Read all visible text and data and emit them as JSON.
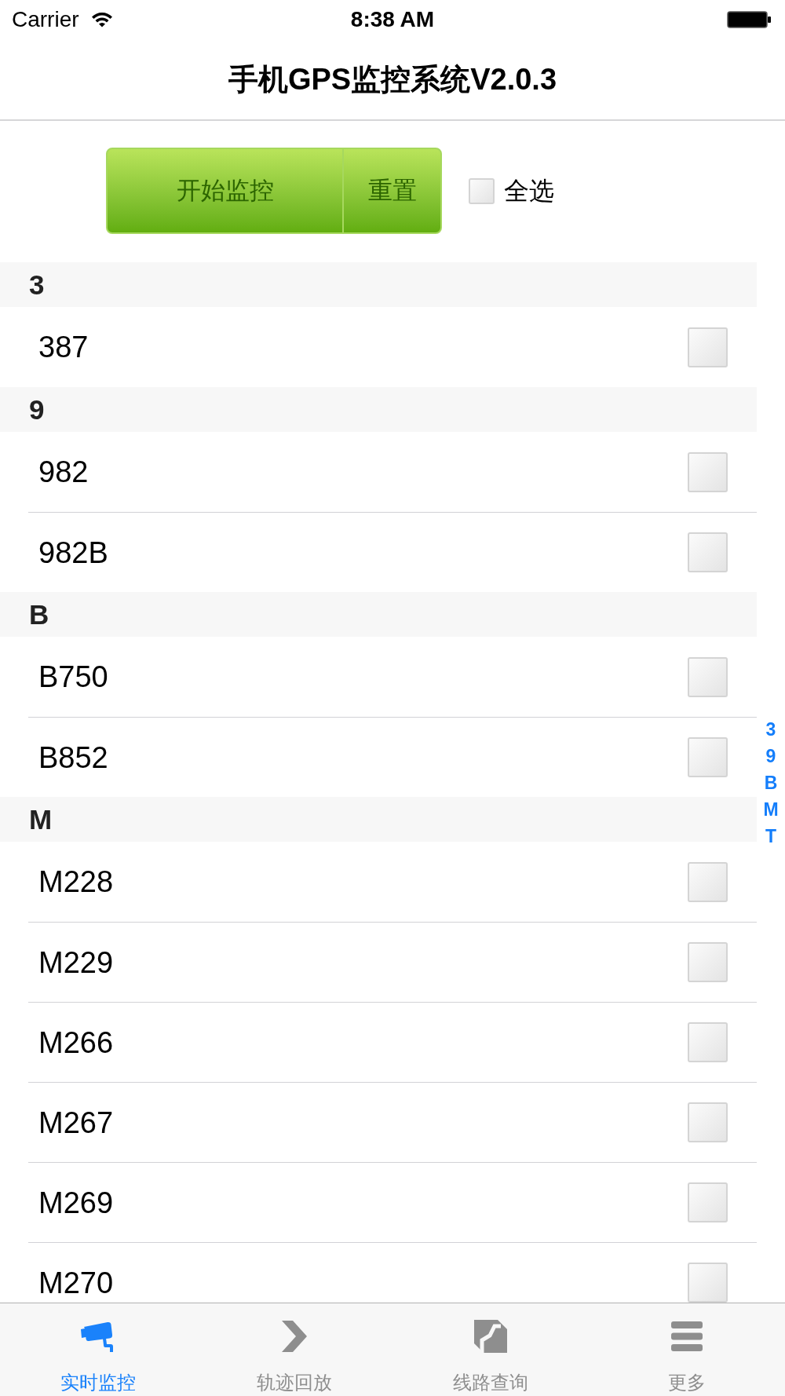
{
  "status_bar": {
    "carrier": "Carrier",
    "time": "8:38 AM"
  },
  "nav_bar": {
    "title": "手机GPS监控系统V2.0.3"
  },
  "toolbar": {
    "start_button": {
      "label": "开始监控"
    },
    "reset_button": {
      "label": "重置"
    },
    "select_all": {
      "label": "全选",
      "checked": false
    }
  },
  "sections": [
    {
      "header": "3",
      "rows": [
        {
          "label": "387",
          "checked": false
        }
      ]
    },
    {
      "header": "9",
      "rows": [
        {
          "label": "982",
          "checked": false
        },
        {
          "label": "982B",
          "checked": false
        }
      ]
    },
    {
      "header": "B",
      "rows": [
        {
          "label": "B750",
          "checked": false
        },
        {
          "label": "B852",
          "checked": false
        }
      ]
    },
    {
      "header": "M",
      "rows": [
        {
          "label": "M228",
          "checked": false
        },
        {
          "label": "M229",
          "checked": false
        },
        {
          "label": "M266",
          "checked": false
        },
        {
          "label": "M267",
          "checked": false
        },
        {
          "label": "M269",
          "checked": false
        },
        {
          "label": "M270",
          "checked": false
        }
      ]
    }
  ],
  "section_index": [
    "3",
    "9",
    "B",
    "M",
    "T"
  ],
  "tab_bar": {
    "tabs": [
      {
        "label": "实时监控",
        "selected": true
      },
      {
        "label": "轨迹回放",
        "selected": false
      },
      {
        "label": "线路查询",
        "selected": false
      },
      {
        "label": "更多",
        "selected": false
      }
    ]
  }
}
